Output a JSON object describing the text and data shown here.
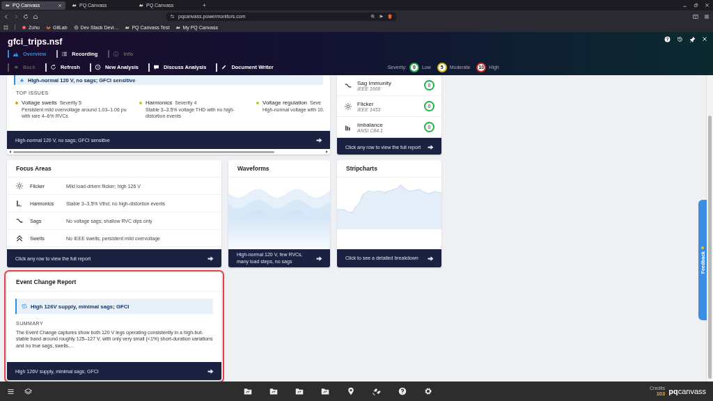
{
  "browser": {
    "tabs": [
      {
        "title": "PQ Canvass",
        "selected": true
      },
      {
        "title": "PQ Canvass",
        "selected": false
      },
      {
        "title": "PQ Canvass",
        "selected": false
      }
    ],
    "url": "pqcanvass.powermonitors.com",
    "bookmarks": [
      {
        "kind": "zoho",
        "label": "Zoho"
      },
      {
        "kind": "gitlab",
        "label": "GitLab"
      },
      {
        "kind": "globe",
        "label": "Dev Stack Devi…"
      },
      {
        "kind": "pq",
        "label": "PQ Canvass Test"
      },
      {
        "kind": "pq",
        "label": "My PQ Canvass"
      }
    ]
  },
  "app": {
    "title": "gfci_trips.nsf",
    "nav": [
      {
        "kind": "overview",
        "label": "Overview",
        "selected": true,
        "disabled": false
      },
      {
        "kind": "recording",
        "label": "Recording",
        "selected": false,
        "disabled": false
      },
      {
        "kind": "info",
        "label": "Info",
        "selected": false,
        "disabled": true
      }
    ],
    "toolbar": [
      {
        "kind": "back",
        "label": "Back",
        "disabled": true
      },
      {
        "kind": "refresh",
        "label": "Refresh",
        "disabled": false
      },
      {
        "kind": "new",
        "label": "New Analysis",
        "disabled": false
      },
      {
        "kind": "discuss",
        "label": "Discuss Analysis",
        "disabled": false
      },
      {
        "kind": "write",
        "label": "Document Writer",
        "disabled": false
      }
    ],
    "severity": {
      "label": "Severity:",
      "levels": [
        {
          "count": "0",
          "label": "Low",
          "color": "#22b04a"
        },
        {
          "count": "5",
          "label": "Moderate",
          "color": "#d9b81c"
        },
        {
          "count": "10",
          "label": "High",
          "color": "#d92a2a"
        }
      ]
    }
  },
  "summary_card": {
    "headline": "High-normal 120 V, no sags; GFCI sensitive",
    "section_label": "TOP ISSUES",
    "issues": [
      {
        "title": "Voltage swells",
        "severity": "Severity 5",
        "detail": "Persistent mild overvoltage around 1.03–1.06 pu with rare 4–6% RVCs",
        "color": "#c9a800"
      },
      {
        "title": "Harmonics",
        "severity": "Severity 4",
        "detail": "Stable 3–3.5% voltage THD with no high-distortion events",
        "color": "#b5cc1e"
      },
      {
        "title": "Voltage regulation",
        "severity": "Seve",
        "detail": "High-normal voltage with 10.",
        "color": "#b5cc1e"
      }
    ],
    "footer": "High-normal 120 V, no sags; GFCI sensitive"
  },
  "standards_card": {
    "rows": [
      {
        "kind": "sag",
        "name": "Sag Immunity",
        "standard": "IEEE 1668",
        "count": "0"
      },
      {
        "kind": "flicker",
        "name": "Flicker",
        "standard": "IEEE 1453",
        "count": "0"
      },
      {
        "kind": "imbalance",
        "name": "Imbalance",
        "standard": "ANSI C84.1",
        "count": "0"
      }
    ],
    "footer": "Click any row to view the full report"
  },
  "focus_areas": {
    "title": "Focus Areas",
    "rows": [
      {
        "kind": "flicker",
        "name": "Flicker",
        "detail": "Mild load-driven flicker; high 126 V"
      },
      {
        "kind": "harmonics",
        "name": "Harmonics",
        "detail": "Stable 3–3.5% Vthd; no high-distortion events"
      },
      {
        "kind": "sags",
        "name": "Sags",
        "detail": "No voltage sags; shallow RVC dips only"
      },
      {
        "kind": "swells",
        "name": "Swells",
        "detail": "No IEEE swells; persistent mild overvoltage"
      }
    ],
    "footer": "Click any row to view the full report"
  },
  "waveforms": {
    "title": "Waveforms",
    "footer": "High-normal 120 V, few RVCs, many load steps, no sags"
  },
  "stripcharts": {
    "title": "Stripcharts",
    "footer": "Click to see a detailed breakdown"
  },
  "event_change": {
    "title": "Event Change Report",
    "selected": true,
    "headline": "High 126V supply, minimal sags; GFCI",
    "section_label": "SUMMARY",
    "summary": "The Event Change captures show both 120 V legs operating consistently in a high-but-stable band around roughly 125–127 V, with only very small (<1%) short-duration variations and no true sags, swells,...",
    "footer": "High 126V supply, minimal sags; GFCI"
  },
  "feedback": {
    "label": "Feedback"
  },
  "taskbar": {
    "credits_label": "Credits",
    "credits": "103",
    "brand": "**pq**canvass"
  }
}
